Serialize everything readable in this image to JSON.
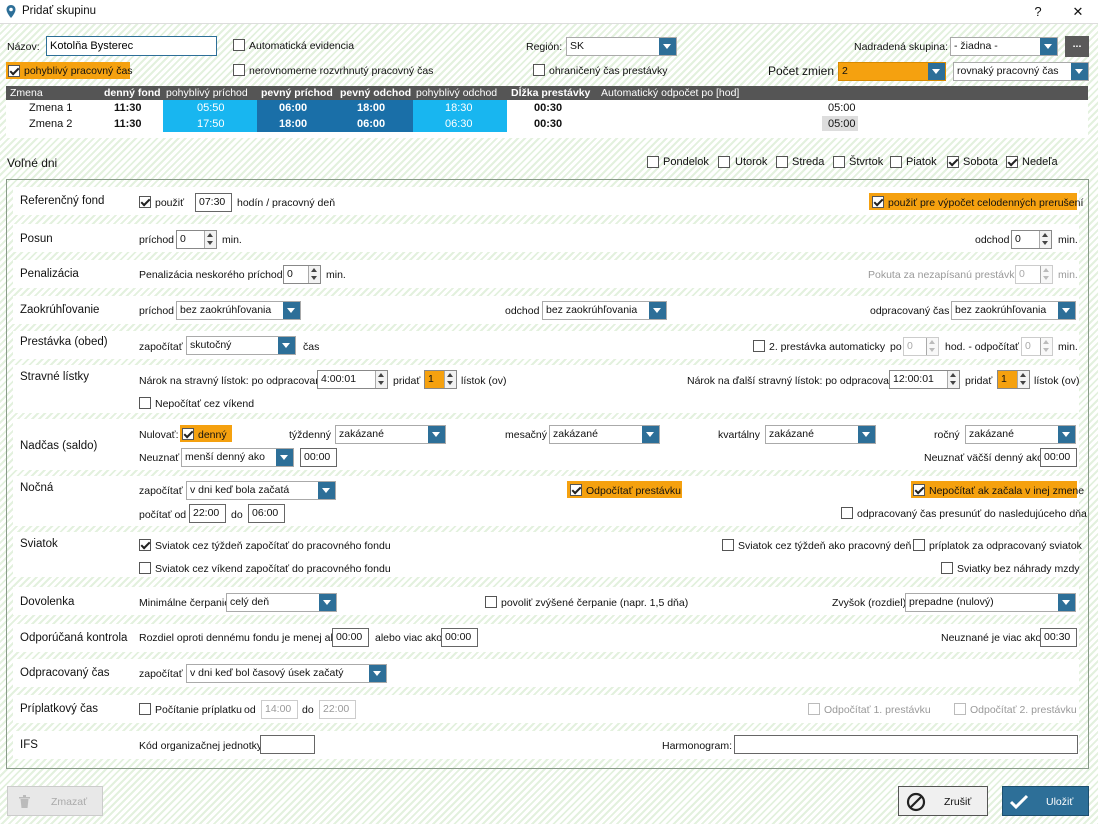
{
  "window": {
    "title": "Pridať skupinu",
    "help": "?",
    "close": "✕"
  },
  "top": {
    "name_label": "Názov:",
    "name_value": "Kotolňa Bysterec",
    "auto_evid": "Automatická evidencia",
    "region_label": "Región:",
    "region_value": "SK",
    "parent_label": "Nadradená skupina:",
    "parent_value": "- žiadna -",
    "more": "...",
    "flexible": "pohyblivý pracovný čas",
    "uneven": "nerovnomerne rozvrhnutý pracovný čas",
    "limited_break": "ohraničený čas prestávky",
    "shifts_label": "Počet zmien",
    "shifts_value": "2",
    "shift_mode": "rovnaký pracovný čas"
  },
  "shift_table": {
    "headers": [
      "Zmena",
      "denný fond",
      "pohyblivý príchod",
      "pevný príchod",
      "pevný odchod",
      "pohyblivý odchod",
      "Dĺžka prestávky",
      "Automatický odpočet po [hod]"
    ],
    "rows": [
      {
        "name": "Zmena 1",
        "fund": "11:30",
        "flex_in": "05:50",
        "fixed_in": "06:00",
        "fixed_out": "18:00",
        "flex_out": "18:30",
        "brk": "00:30",
        "auto": "05:00"
      },
      {
        "name": "Zmena 2",
        "fund": "11:30",
        "flex_in": "17:50",
        "fixed_in": "18:00",
        "fixed_out": "06:00",
        "flex_out": "06:30",
        "brk": "00:30",
        "auto": "05:00"
      }
    ]
  },
  "days": {
    "label": "Voľné dni",
    "items": [
      "Pondelok",
      "Utorok",
      "Streda",
      "Štvrtok",
      "Piatok",
      "Sobota",
      "Nedeľa"
    ]
  },
  "ref": {
    "title": "Referenčný fond",
    "use": "použiť",
    "value": "07:30",
    "unit": "hodín / pracovný deň",
    "full": "použiť pre výpočet celodenných prerušení"
  },
  "shift": {
    "title": "Posun",
    "in": "príchod",
    "in_v": "0",
    "min": "min.",
    "out": "odchod",
    "out_v": "0"
  },
  "pen": {
    "title": "Penalizácia",
    "label": "Penalizácia neskorého príchodu:",
    "value": "0",
    "min": "min.",
    "fine": "Pokuta za nezapísanú prestávku",
    "fine_v": "0"
  },
  "round": {
    "title": "Zaokrúhľovanie",
    "in": "príchod",
    "out": "odchod",
    "worked": "odpracovaný čas",
    "opt": "bez zaokrúhľovania"
  },
  "brk": {
    "title": "Prestávka (obed)",
    "count": "započítať",
    "count_v": "skutočný",
    "time": "čas",
    "second": "2. prestávka automaticky",
    "po": "po",
    "po_v": "0",
    "hod": "hod. - odpočítať",
    "odp_v": "0",
    "min": "min."
  },
  "meal": {
    "title": "Stravné lístky",
    "claim": "Nárok na stravný lístok: po odpracovaní",
    "claim_v": "4:00:01",
    "add": "pridať",
    "add_v": "1",
    "ticket": "lístok (ov)",
    "claim2": "Nárok na ďalší stravný lístok: po odpracovaní",
    "claim2_v": "12:00:01",
    "add2_v": "1",
    "weekend": "Nepočítať cez víkend"
  },
  "ot": {
    "title": "Nadčas (saldo)",
    "reset": "Nulovať:",
    "daily": "denný",
    "weekly": "týždenný",
    "monthly": "mesačný",
    "quarterly": "kvartálny",
    "yearly": "ročný",
    "forbidden": "zakázané",
    "ignore": "Neuznať",
    "ignore_v": "menší denný ako",
    "ignore_t": "00:00",
    "ignore2": "Neuznať väčší denný ako",
    "ignore2_t": "00:00"
  },
  "night": {
    "title": "Nočná",
    "count": "započítať",
    "count_v": "v dni keď bola začatá",
    "deduct": "Odpočítať prestávku",
    "notcount": "Nepočítať ak začala v inej zmene",
    "from": "počítať od",
    "from_v": "22:00",
    "to": "do",
    "to_v": "06:00",
    "move": "odpracovaný čas presunúť do nasledujúceho dňa"
  },
  "hol": {
    "title": "Sviatok",
    "a": "Sviatok cez týždeň započítať do pracovného fondu",
    "b": "Sviatok cez víkend započítať do pracovného fondu",
    "c": "Sviatok cez týždeň ako pracovný deň",
    "d": "príplatok za odpracovaný sviatok",
    "e": "Sviatky bez náhrady mzdy"
  },
  "vac": {
    "title": "Dovolenka",
    "min": "Minimálne čerpanie",
    "min_v": "celý deň",
    "allow": "povoliť zvýšené čerpanie (napr. 1,5 dňa)",
    "rest": "Zvyšok (rozdiel)",
    "rest_v": "prepadne (nulový)"
  },
  "rec": {
    "title": "Odporúčaná kontrola",
    "a": "Rozdiel oproti dennému fondu je menej ako",
    "a_v": "00:00",
    "b": "alebo viac ako",
    "b_v": "00:00",
    "c": "Neuznané je viac ako",
    "c_v": "00:30"
  },
  "worked": {
    "title": "Odpracovaný čas",
    "count": "započítať",
    "count_v": "v dni keď bol časový úsek  začatý"
  },
  "bonus": {
    "title": "Príplatkový čas",
    "count": "Počítanie príplatku",
    "od": "od",
    "od_v": "14:00",
    "do": "do",
    "do_v": "22:00",
    "b1": "Odpočítať 1. prestávku",
    "b2": "Odpočítať 2. prestávku"
  },
  "ifs": {
    "title": "IFS",
    "code": "Kód organizačnej jednotky",
    "harm": "Harmonogram:"
  },
  "buttons": {
    "delete": "Zmazať",
    "cancel": "Zrušiť",
    "save": "Uložiť"
  },
  "colors": {
    "accent": "#2d6f98",
    "orange": "#f5a10f",
    "cyan": "#18b6f0",
    "darkblue": "#1a6fa8"
  }
}
